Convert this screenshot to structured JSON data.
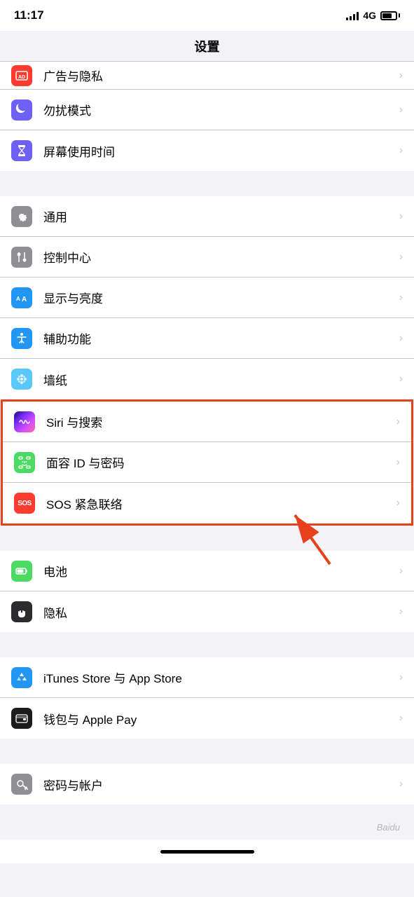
{
  "statusBar": {
    "time": "11:17",
    "signal": "4G",
    "battery": 70
  },
  "navTitle": "设置",
  "partialItem": {
    "label": "广告与隐私",
    "iconBg": "red"
  },
  "groups": [
    {
      "id": "group1",
      "items": [
        {
          "id": "do-not-disturb",
          "label": "勿扰模式",
          "iconBg": "#6e5ff5",
          "iconType": "moon"
        },
        {
          "id": "screen-time",
          "label": "屏幕使用时间",
          "iconBg": "#6e5ff5",
          "iconType": "hourglass"
        }
      ]
    },
    {
      "id": "group2",
      "items": [
        {
          "id": "general",
          "label": "通用",
          "iconBg": "#8e8e93",
          "iconType": "gear"
        },
        {
          "id": "control-center",
          "label": "控制中心",
          "iconBg": "#8e8e93",
          "iconType": "sliders"
        },
        {
          "id": "display-brightness",
          "label": "显示与亮度",
          "iconBg": "#2196f3",
          "iconType": "aa"
        },
        {
          "id": "accessibility",
          "label": "辅助功能",
          "iconBg": "#2196f3",
          "iconType": "accessibility"
        },
        {
          "id": "wallpaper",
          "label": "墙纸",
          "iconBg": "#5ac8fa",
          "iconType": "flower"
        }
      ]
    },
    {
      "id": "group3",
      "highlighted": true,
      "items": [
        {
          "id": "siri",
          "label": "Siri 与搜索",
          "iconBg": "siri",
          "iconType": "siri"
        },
        {
          "id": "face-id",
          "label": "面容 ID 与密码",
          "iconBg": "#4cd964",
          "iconType": "faceid"
        },
        {
          "id": "sos",
          "label": "SOS 紧急联络",
          "iconBg": "#ff3b30",
          "iconType": "sos"
        }
      ]
    },
    {
      "id": "group4",
      "items": [
        {
          "id": "battery",
          "label": "电池",
          "iconBg": "#4cd964",
          "iconType": "battery"
        },
        {
          "id": "privacy",
          "label": "隐私",
          "iconBg": "#2c2c2e",
          "iconType": "hand"
        }
      ]
    },
    {
      "id": "group5",
      "items": [
        {
          "id": "itunes-appstore",
          "label": "iTunes Store 与 App Store",
          "iconBg": "#2196f3",
          "iconType": "appstore"
        },
        {
          "id": "wallet-applepay",
          "label": "钱包与 Apple Pay",
          "iconBg": "#1c1c1e",
          "iconType": "wallet"
        }
      ]
    },
    {
      "id": "group6",
      "items": [
        {
          "id": "passwords-accounts",
          "label": "密码与帐户",
          "iconBg": "#8e8e93",
          "iconType": "key"
        }
      ]
    }
  ],
  "annotation": {
    "arrowText": "→"
  }
}
